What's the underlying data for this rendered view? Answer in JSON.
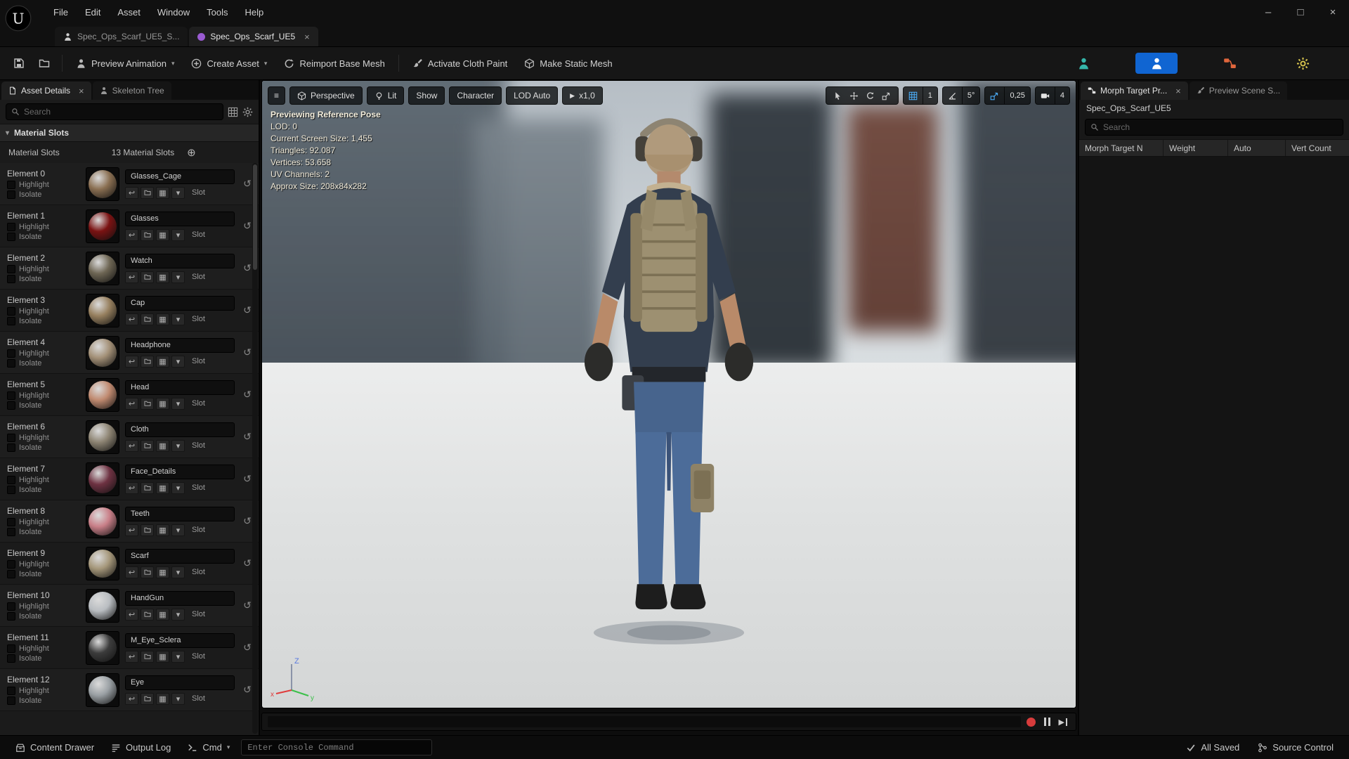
{
  "colors": {
    "accent_blue": "#1065d2",
    "highlight_blue": "#4db1ff",
    "record_red": "#d83c3c",
    "asset_icon_purple": "#9a5bd2",
    "axis_x": "#e03c3c",
    "axis_y": "#3cc04a",
    "axis_z": "#5a7ae0"
  },
  "icons": {
    "close": "×",
    "caret": "▾",
    "hamburger": "≡",
    "plus_circle": "⊕",
    "undo": "↺",
    "assign": "↩",
    "play": "▶",
    "pick": "▦",
    "collapse_arrow": "▾"
  },
  "app": {
    "menu": [
      "File",
      "Edit",
      "Asset",
      "Window",
      "Tools",
      "Help"
    ],
    "tabs": [
      {
        "label": "Spec_Ops_Scarf_UE5_S...",
        "active": false
      },
      {
        "label": "Spec_Ops_Scarf_UE5",
        "active": true
      }
    ],
    "window_controls": {
      "minimize": "–",
      "maximize": "□",
      "close": "×"
    }
  },
  "toolbar": {
    "preview_animation": "Preview Animation",
    "create_asset": "Create Asset",
    "reimport_base_mesh": "Reimport Base Mesh",
    "activate_cloth_paint": "Activate Cloth Paint",
    "make_static_mesh": "Make Static Mesh"
  },
  "left_panel": {
    "tabs": [
      {
        "label": "Asset Details",
        "active": true
      },
      {
        "label": "Skeleton Tree",
        "active": false
      }
    ],
    "search_placeholder": "Search",
    "section_title": "Material Slots",
    "slots_label": "Material Slots",
    "slots_count": "13 Material Slots",
    "labels": {
      "highlight": "Highlight",
      "isolate": "Isolate",
      "slot": "Slot"
    },
    "elements": [
      {
        "label": "Element 0",
        "material": "Glasses_Cage",
        "color": "#8a6f52"
      },
      {
        "label": "Element 1",
        "material": "Glasses",
        "color": "#7a1212"
      },
      {
        "label": "Element 2",
        "material": "Watch",
        "color": "#6e6654"
      },
      {
        "label": "Element 3",
        "material": "Cap",
        "color": "#97805f"
      },
      {
        "label": "Element 4",
        "material": "Headphone",
        "color": "#a39077"
      },
      {
        "label": "Element 5",
        "material": "Head",
        "color": "#c08a70"
      },
      {
        "label": "Element 6",
        "material": "Cloth",
        "color": "#8d8473"
      },
      {
        "label": "Element 7",
        "material": "Face_Details",
        "color": "#6e3242"
      },
      {
        "label": "Element 8",
        "material": "Teeth",
        "color": "#c97f88"
      },
      {
        "label": "Element 9",
        "material": "Scarf",
        "color": "#a5977a"
      },
      {
        "label": "Element 10",
        "material": "HandGun",
        "color": "#b9bdc1"
      },
      {
        "label": "Element 11",
        "material": "M_Eye_Sclera",
        "color": "#3c3c3c"
      },
      {
        "label": "Element 12",
        "material": "Eye",
        "color": "#9aa0a4"
      }
    ]
  },
  "viewport": {
    "buttons": {
      "perspective": "Perspective",
      "lit": "Lit",
      "show": "Show",
      "character": "Character",
      "lod": "LOD Auto",
      "speed": "x1,0"
    },
    "snaps": {
      "grid": "1",
      "angle": "5°",
      "scale": "0,25",
      "camera": "4"
    },
    "stats": [
      "Previewing Reference Pose",
      "LOD: 0",
      "Current Screen Size: 1,455",
      "Triangles: 92.087",
      "Vertices: 53.658",
      "UV Channels: 2",
      "Approx Size: 208x84x282"
    ],
    "axis": {
      "x": "x",
      "y": "y",
      "z": "Z"
    }
  },
  "right_panel": {
    "tabs": [
      {
        "label": "Morph Target Pr...",
        "active": true
      },
      {
        "label": "Preview Scene S...",
        "active": false
      }
    ],
    "asset_name": "Spec_Ops_Scarf_UE5",
    "search_placeholder": "Search",
    "columns": [
      "Morph Target N",
      "Weight",
      "Auto",
      "Vert Count"
    ]
  },
  "status_bar": {
    "content_drawer": "Content Drawer",
    "output_log": "Output Log",
    "cmd": "Cmd",
    "console_placeholder": "Enter Console Command",
    "all_saved": "All Saved",
    "source_control": "Source Control"
  }
}
